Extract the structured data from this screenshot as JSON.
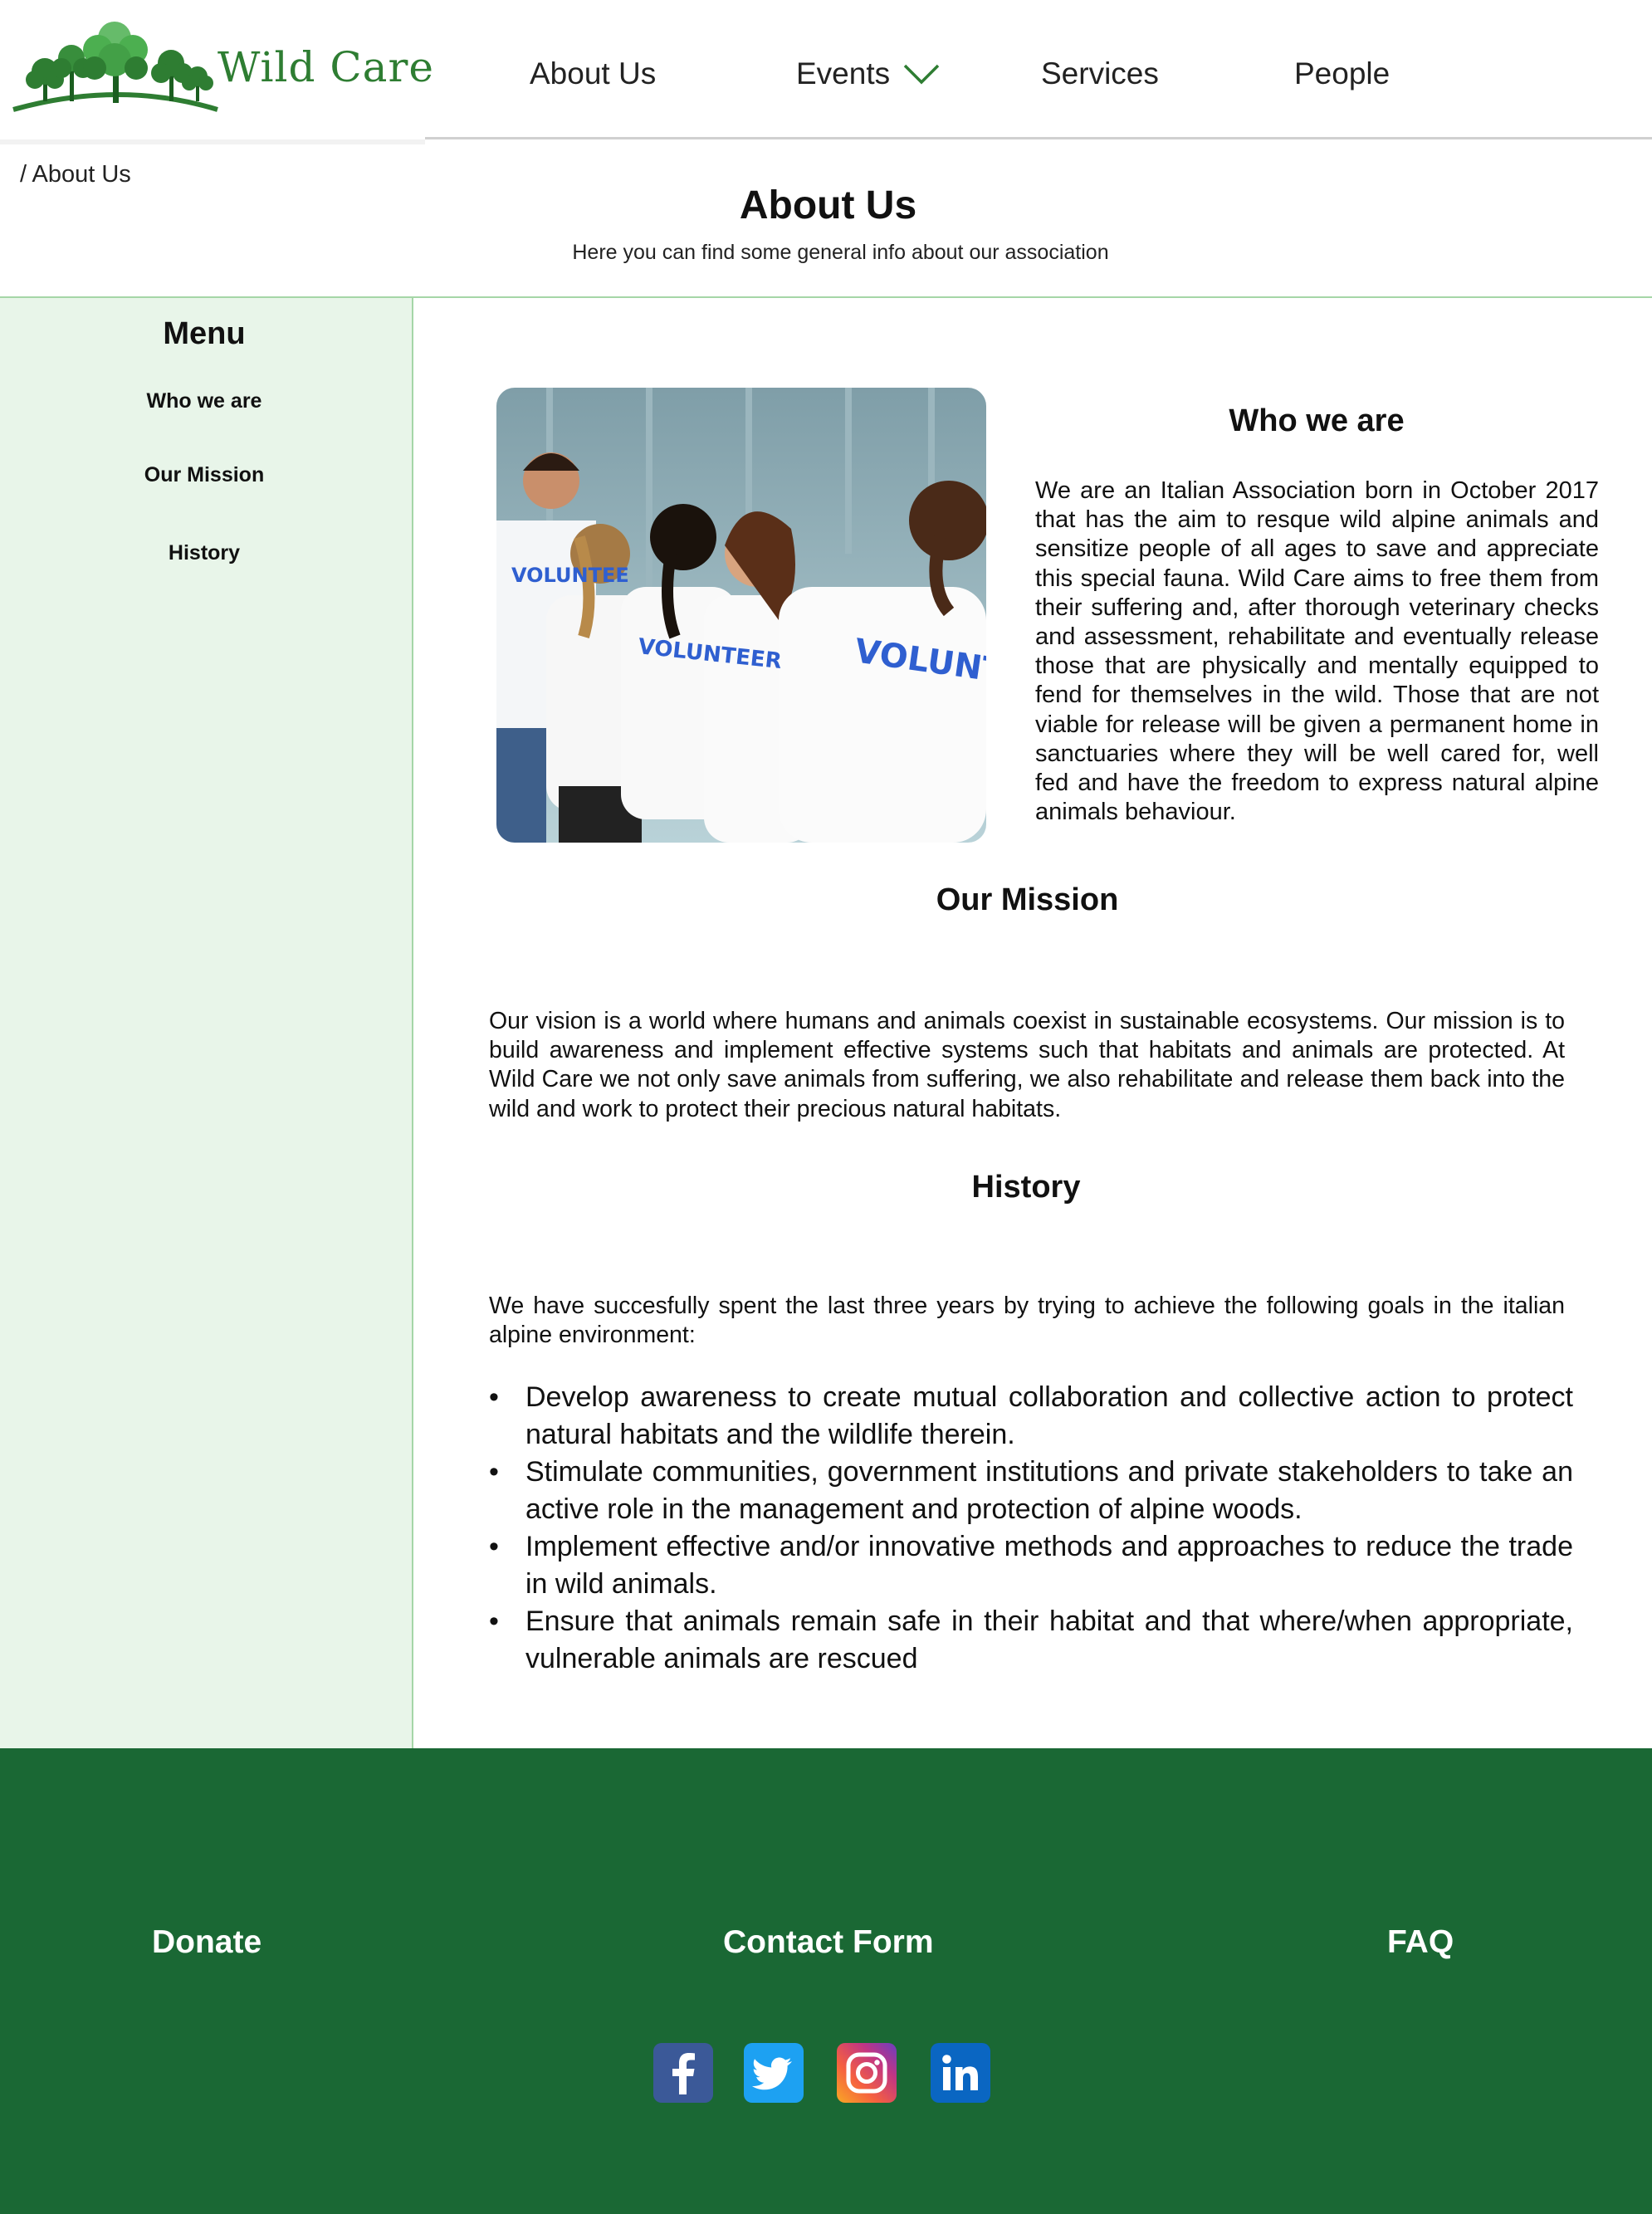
{
  "brand": {
    "name": "Wild Care",
    "color": "#2e7d32"
  },
  "nav": {
    "items": [
      {
        "label": "About Us"
      },
      {
        "label": "Events",
        "icon": "chevron-down-icon"
      },
      {
        "label": "Services"
      },
      {
        "label": "People"
      }
    ]
  },
  "breadcrumb": "/ About Us",
  "page": {
    "title": "About Us",
    "subtitle": "Here you can find some general info about our association"
  },
  "sidebar": {
    "title": "Menu",
    "items": [
      "Who we are",
      "Our Mission",
      "History"
    ]
  },
  "who": {
    "title": "Who we are",
    "text": "We are an Italian Association born in October 2017 that has the aim to resque wild alpine animals and sensitize people of all ages to save and appreciate this special fauna.  Wild Care aims to free them from their suffering and, after thorough veterinary checks and assessment, rehabilitate and eventually release those that are physically and mentally equipped to fend for themselves in the wild. Those that are not viable for release will be given a permanent home in sanctuaries where they will be well cared for, well fed and have the freedom to express natural alpine animals behaviour.",
    "photo_shirt_text": "VOLUNTEER"
  },
  "mission": {
    "title": "Our Mission",
    "text": "Our vision is a world where humans and animals coexist in sustainable ecosystems. Our mission is to build awareness and implement effective systems such that habitats and animals are protected. At Wild Care we not only save animals from suffering, we also rehabilitate and release them back into the wild and work to protect their precious natural habitats."
  },
  "history": {
    "title": "History",
    "intro": "We have succesfully spent the last three years by trying to achieve the following goals in the italian alpine environment:",
    "goals": [
      " Develop awareness to create mutual collaboration and collective action to protect natural habitats and the wildlife therein.",
      "Stimulate communities, government institutions and private stakeholders to take an active role in the management and protection of alpine woods.",
      "Implement effective and/or innovative methods and approaches to reduce the trade in wild animals.",
      "Ensure that animals remain safe in their habitat and that where/when appropriate, vulnerable animals are rescued"
    ]
  },
  "footer": {
    "background": "#1a6834",
    "links": [
      "Donate",
      "Contact Form",
      "FAQ"
    ],
    "social": [
      "facebook-icon",
      "twitter-icon",
      "instagram-icon",
      "linkedin-icon"
    ]
  },
  "colors": {
    "sidebar_bg": "#e8f5e9",
    "divider": "#a5d6a7"
  }
}
